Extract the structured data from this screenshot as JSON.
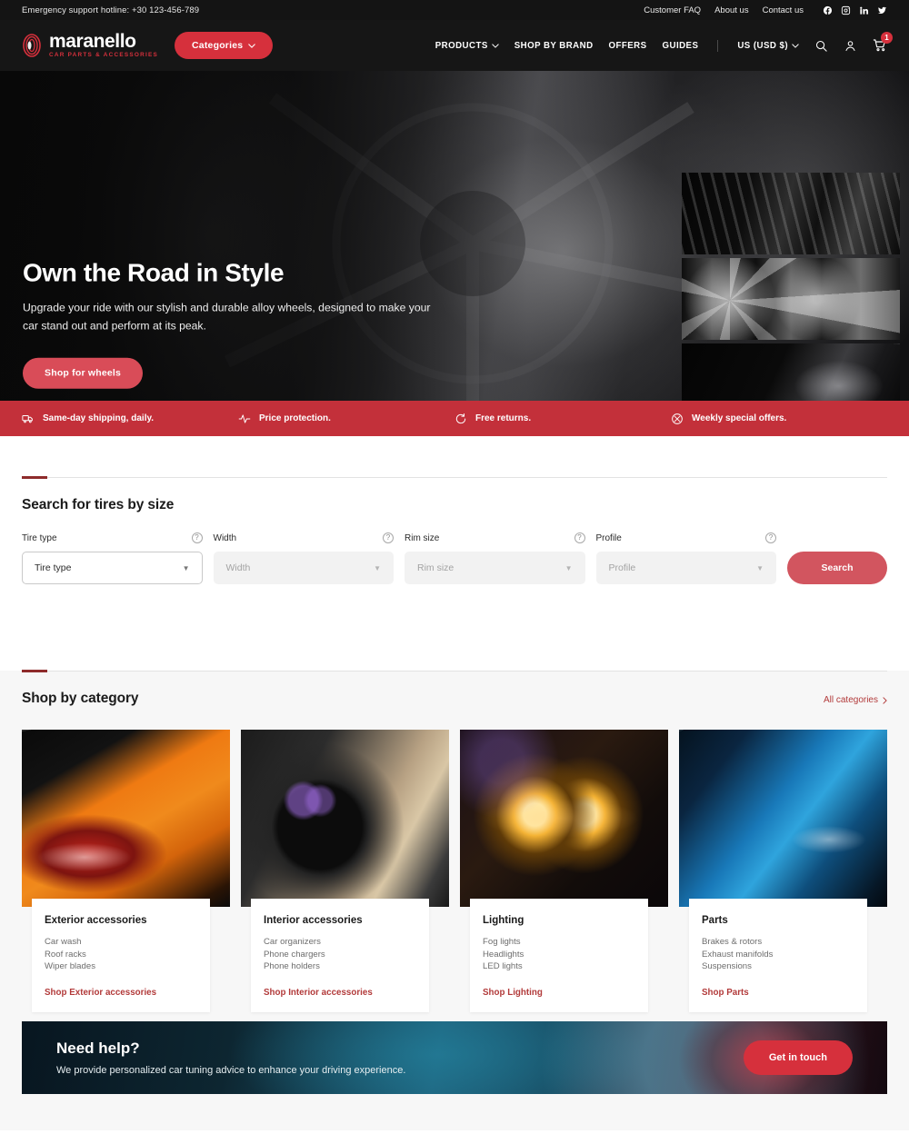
{
  "utilbar": {
    "hotline": "Emergency support hotline: +30 123-456-789",
    "links": [
      {
        "label": "Customer FAQ",
        "name": "customer-faq"
      },
      {
        "label": "About us",
        "name": "about-us"
      },
      {
        "label": "Contact us",
        "name": "contact-us"
      }
    ],
    "social": [
      "facebook-icon",
      "instagram-icon",
      "linkedin-icon",
      "twitter-icon"
    ]
  },
  "brand": {
    "name": "maranello",
    "tagline": "CAR PARTS & ACCESSORIES",
    "categories_button": "Categories"
  },
  "nav": {
    "items": [
      {
        "label": "PRODUCTS",
        "has_caret": true
      },
      {
        "label": "SHOP BY BRAND",
        "has_caret": false
      },
      {
        "label": "OFFERS",
        "has_caret": false
      },
      {
        "label": "GUIDES",
        "has_caret": false
      }
    ],
    "currency": "US (USD $)",
    "cart_count": "1"
  },
  "hero": {
    "title": "Own the Road in Style",
    "subtitle": "Upgrade your ride with our stylish and durable alloy wheels, designed to make your car stand out and perform at its peak.",
    "cta": "Shop for wheels",
    "thumbnails": [
      "tire-tread-thumbnail",
      "alloy-wheels-thumbnail",
      "car-profile-thumbnail"
    ]
  },
  "features": [
    {
      "label": "Same-day shipping, daily.",
      "icon": "truck-icon"
    },
    {
      "label": "Price protection.",
      "icon": "pulse-icon"
    },
    {
      "label": "Free returns.",
      "icon": "refresh-icon"
    },
    {
      "label": "Weekly special offers.",
      "icon": "tag-icon"
    }
  ],
  "tire_search": {
    "title": "Search for tires by size",
    "fields": [
      {
        "label": "Tire type",
        "value": "Tire type",
        "placeholder": "Tire type",
        "state": "active"
      },
      {
        "label": "Width",
        "value": "",
        "placeholder": "Width",
        "state": "muted"
      },
      {
        "label": "Rim size",
        "value": "",
        "placeholder": "Rim size",
        "state": "muted"
      },
      {
        "label": "Profile",
        "value": "",
        "placeholder": "Profile",
        "state": "muted"
      }
    ],
    "help_glyph": "?",
    "submit": "Search"
  },
  "shop_by_category": {
    "title": "Shop by category",
    "all_link": "All categories",
    "cards": [
      {
        "name": "Exterior accessories",
        "items": [
          "Car wash",
          "Roof racks",
          "Wiper blades"
        ],
        "shop_label": "Shop Exterior accessories",
        "image": "orange-sports-car-taillight"
      },
      {
        "name": "Interior accessories",
        "items": [
          "Car organizers",
          "Phone chargers",
          "Phone holders"
        ],
        "shop_label": "Shop Interior accessories",
        "image": "car-interior-steering-wheel"
      },
      {
        "name": "Lighting",
        "items": [
          "Fog lights",
          "Headlights",
          "LED lights"
        ],
        "shop_label": "Shop Lighting",
        "image": "glowing-headlight-rings"
      },
      {
        "name": "Parts",
        "items": [
          "Brakes & rotors",
          "Exhaust manifolds",
          "Suspensions"
        ],
        "shop_label": "Shop Parts",
        "image": "blue-car-body-panel"
      }
    ]
  },
  "help_banner": {
    "title": "Need help?",
    "subtitle": "We provide personalized car tuning advice to enhance your driving experience.",
    "cta": "Get in touch"
  },
  "colors": {
    "brand_red": "#d6303c",
    "feature_bar_red": "#c3303a",
    "muted_red": "#d2555f",
    "link_red": "#b23a3a",
    "dark": "#161616"
  }
}
